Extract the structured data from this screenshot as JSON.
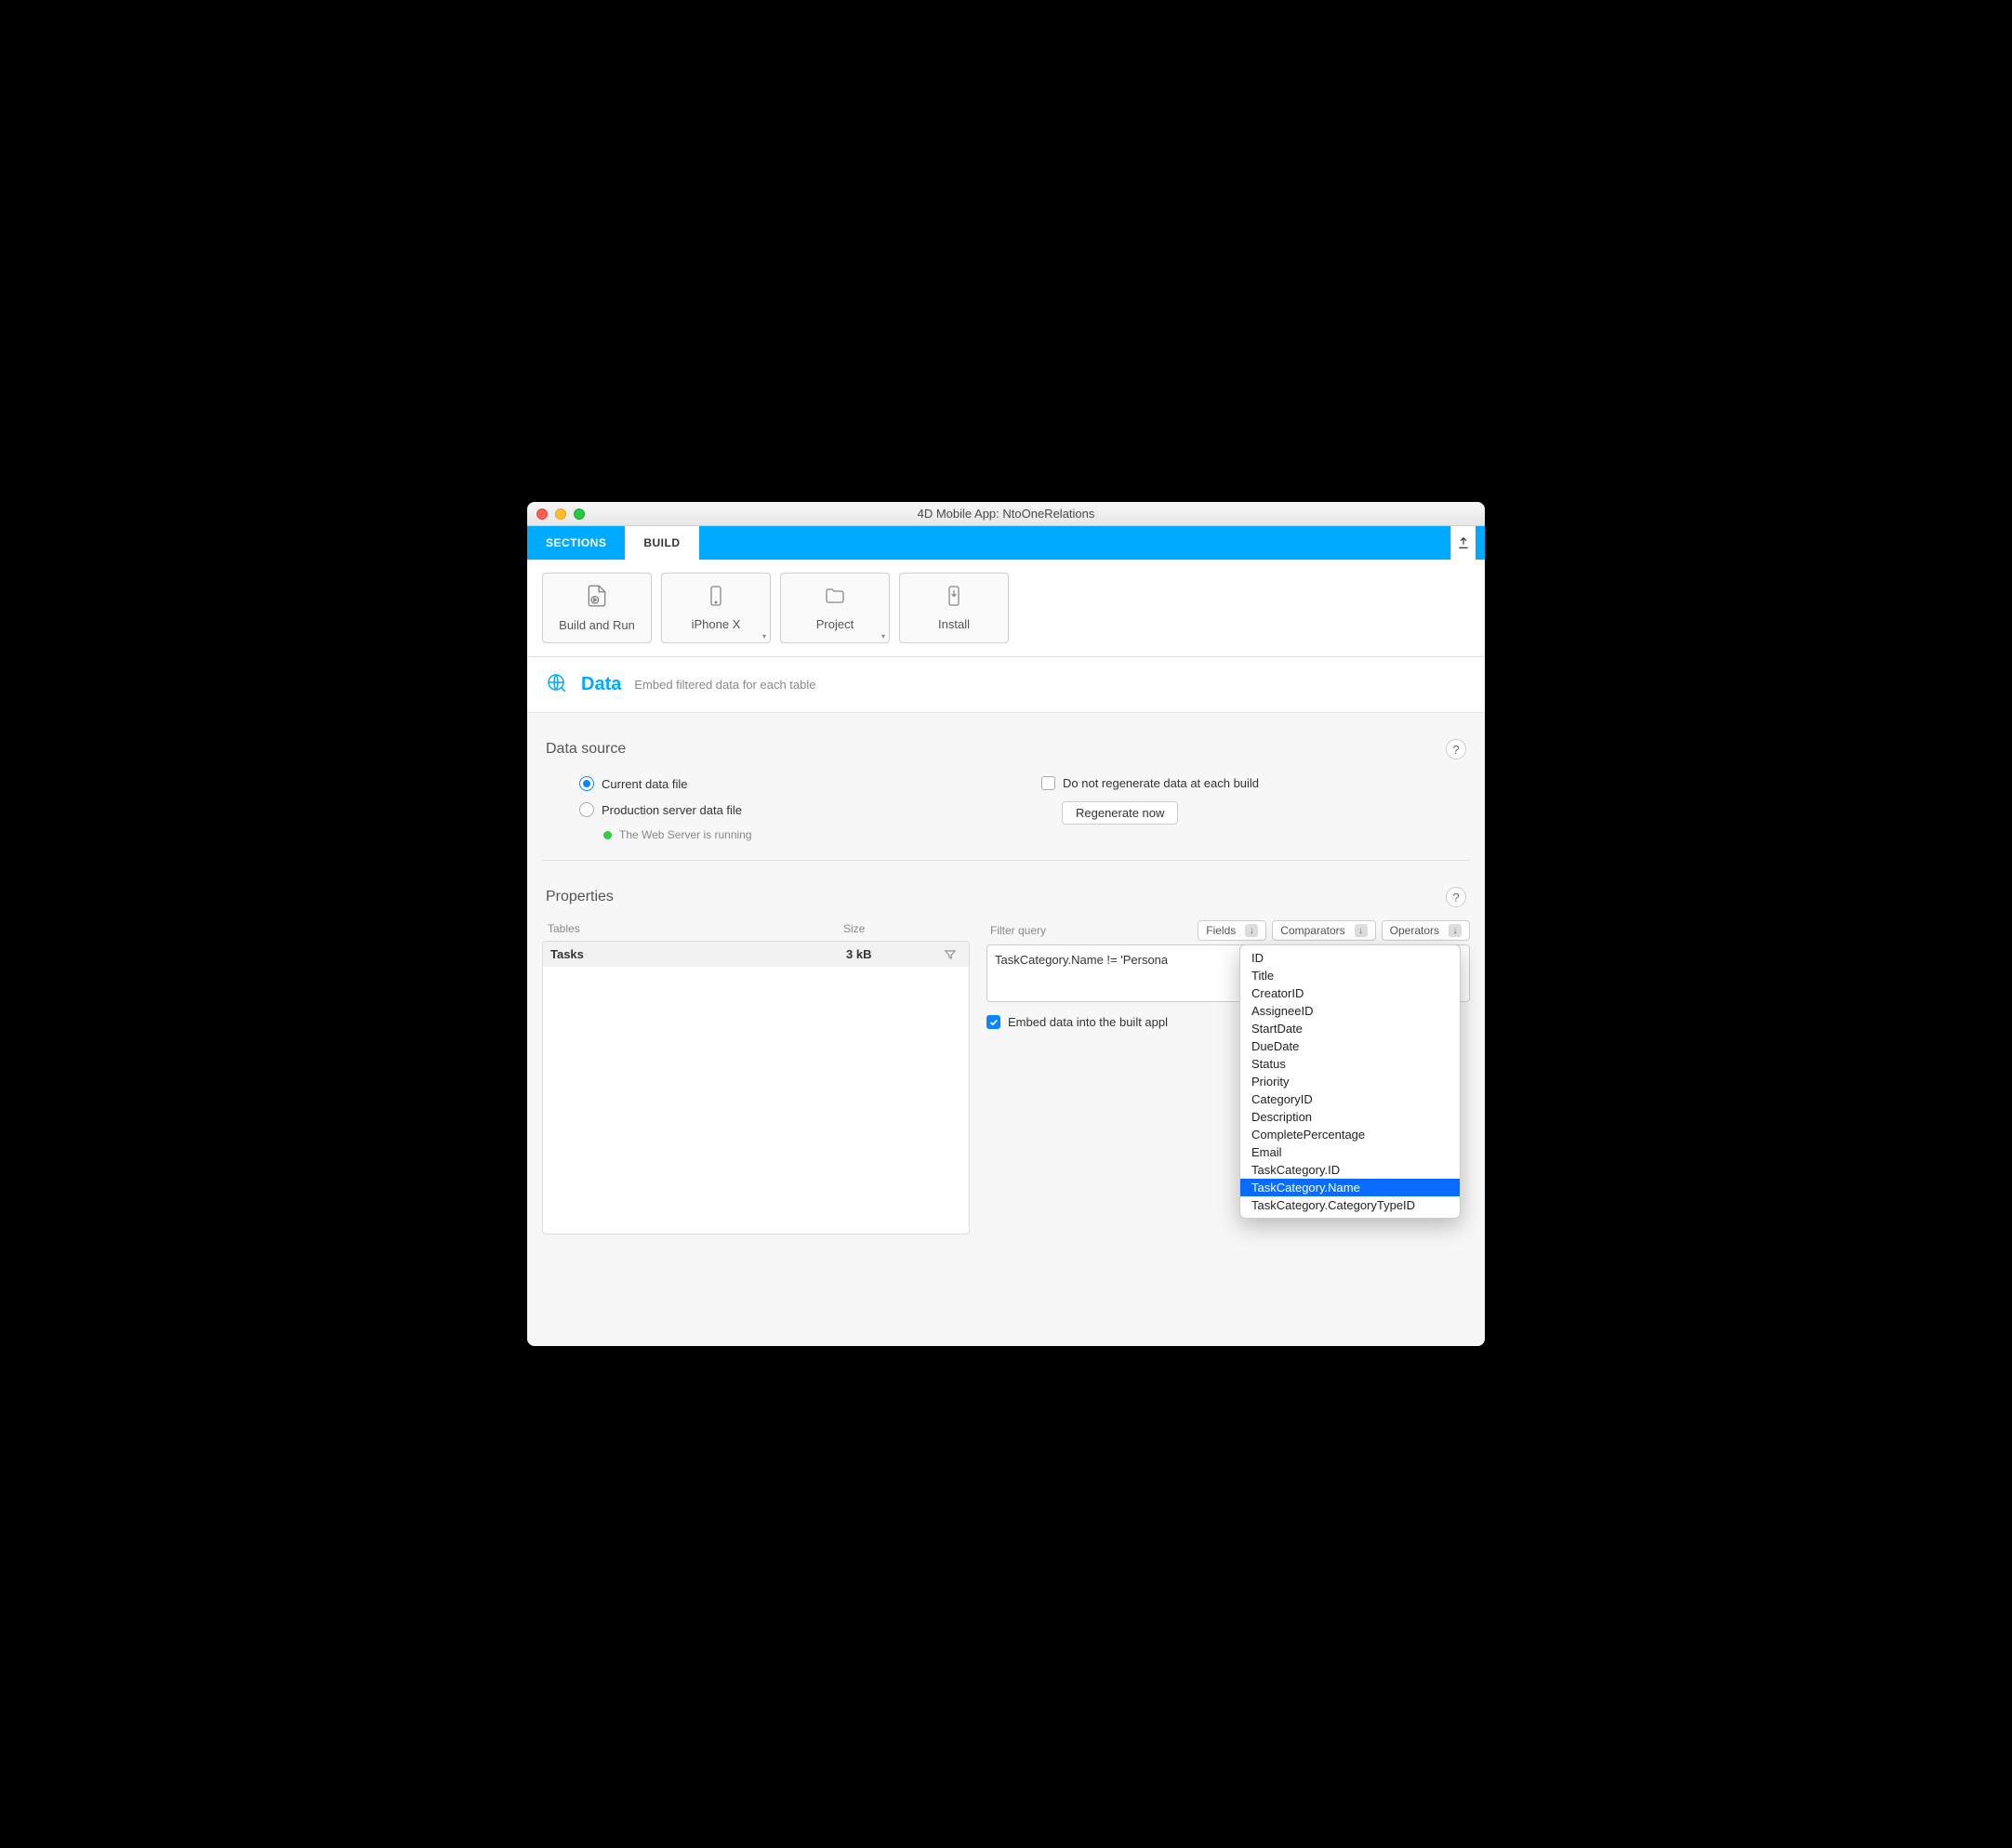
{
  "window": {
    "title": "4D Mobile App: NtoOneRelations"
  },
  "tabs": {
    "sections": "SECTIONS",
    "build": "BUILD"
  },
  "toolbar": {
    "buildrun": "Build and Run",
    "device": "iPhone X",
    "project": "Project",
    "install": "Install"
  },
  "section": {
    "title": "Data",
    "subtitle": "Embed filtered data for each table"
  },
  "datasource": {
    "heading": "Data source",
    "current": "Current data file",
    "production": "Production server data file",
    "status": "The Web Server is running",
    "no_regen": "Do not regenerate data at each build",
    "regen_btn": "Regenerate now"
  },
  "properties": {
    "heading": "Properties",
    "col_tables": "Tables",
    "col_size": "Size",
    "row_name": "Tasks",
    "row_size": "3 kB",
    "filter_label": "Filter query",
    "fields_btn": "Fields",
    "comparators_btn": "Comparators",
    "operators_btn": "Operators",
    "query": "TaskCategory.Name != 'Persona",
    "embed": "Embed data into the built appl"
  },
  "fields_dropdown": [
    "ID",
    "Title",
    "CreatorID",
    "AssigneeID",
    "StartDate",
    "DueDate",
    "Status",
    "Priority",
    "CategoryID",
    "Description",
    "CompletePercentage",
    "Email",
    "TaskCategory.ID",
    "TaskCategory.Name",
    "TaskCategory.CategoryTypeID"
  ],
  "fields_selected_index": 13
}
